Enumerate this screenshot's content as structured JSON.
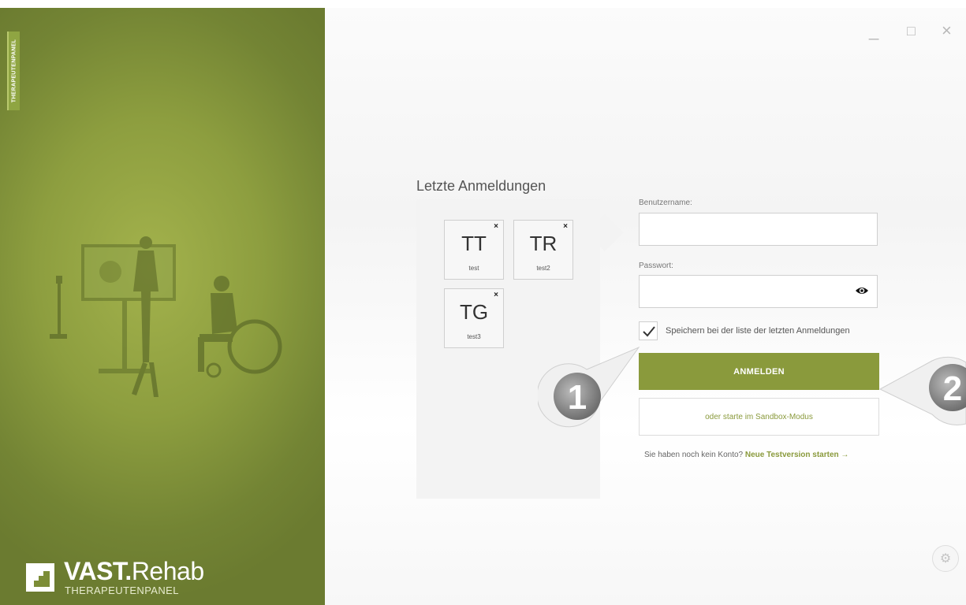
{
  "sidebar": {
    "vertical_tab": "THERAPEUTENPANEL",
    "logo": {
      "brand_bold": "VAST.",
      "brand_light": "Rehab",
      "subtitle": "THERAPEUTENPANEL"
    }
  },
  "window_controls": {
    "minimize": "_",
    "maximize": "□",
    "close": "×"
  },
  "recent_logins": {
    "title": "Letzte Anmeldungen",
    "close_symbol": "×",
    "tiles": [
      {
        "initials": "TT",
        "name": "test"
      },
      {
        "initials": "TR",
        "name": "test2"
      },
      {
        "initials": "TG",
        "name": "test3"
      }
    ]
  },
  "login_form": {
    "username_label": "Benutzername:",
    "username_value": "",
    "password_label": "Passwort:",
    "password_value": "",
    "remember_label": "Speichern bei der liste der letzten Anmeldungen",
    "remember_checked": true,
    "login_button": "ANMELDEN",
    "sandbox_button": "oder starte im Sandbox-Modus",
    "signup_prompt": "Sie haben noch kein Konto?",
    "signup_link": "Neue Testversion starten →"
  },
  "callouts": {
    "one": "1",
    "two": "2"
  },
  "colors": {
    "accent": "#8a9a3c",
    "panel": "#7c8d37"
  }
}
